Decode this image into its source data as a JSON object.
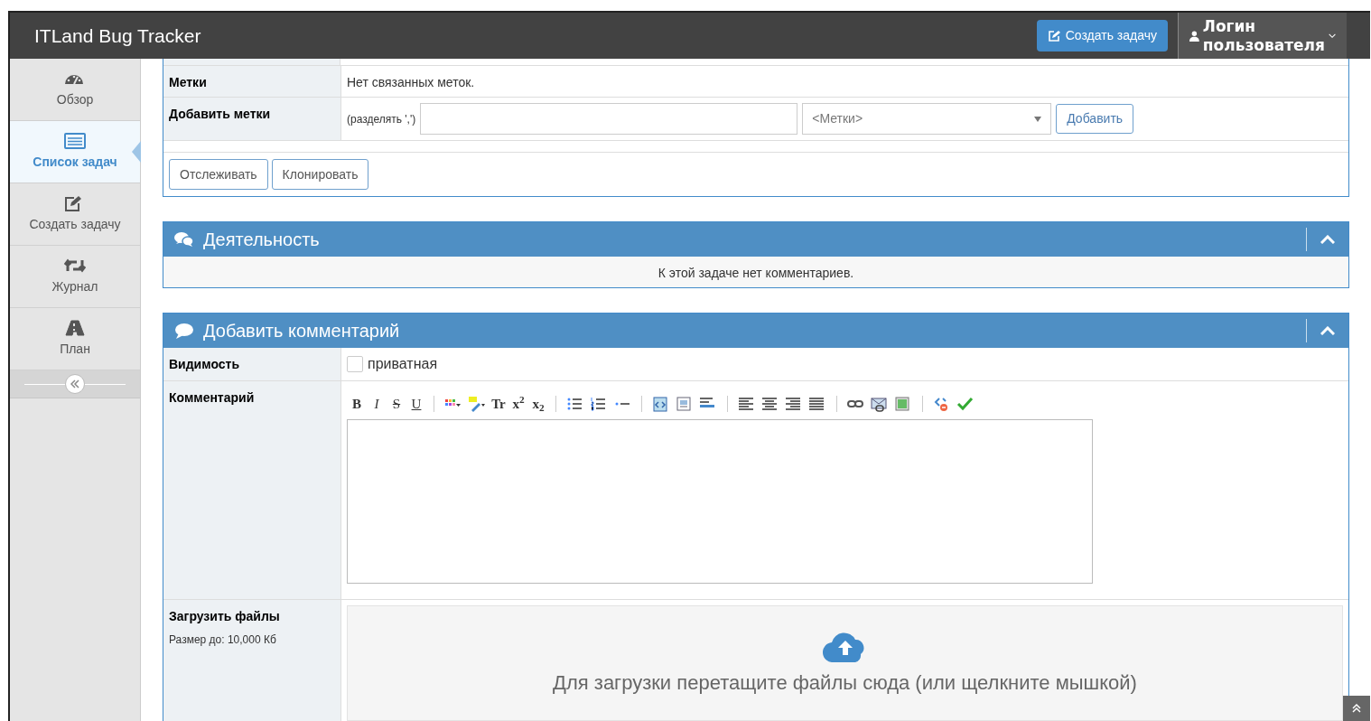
{
  "header": {
    "title": "ITLand Bug Tracker",
    "create_button": "Создать задачу",
    "user_menu": "Логин пользователя"
  },
  "sidebar": {
    "items": [
      {
        "kind": "overview",
        "label": "Обзор",
        "selected": false
      },
      {
        "kind": "list",
        "label": "Список задач",
        "selected": true
      },
      {
        "kind": "create",
        "label": "Создать задачу",
        "selected": false
      },
      {
        "kind": "journal",
        "label": "Журнал",
        "selected": false
      },
      {
        "kind": "plan",
        "label": "План",
        "selected": false
      }
    ]
  },
  "details": {
    "rows": [
      {
        "kind": "text",
        "label": "Метки",
        "value": "Нет связанных меток."
      },
      {
        "kind": "add_tags",
        "label": "Добавить метки",
        "hint": "(разделять ',')",
        "select_placeholder": "<Метки>",
        "button": "Добавить"
      }
    ],
    "buttons": [
      "Отслеживать",
      "Клонировать"
    ]
  },
  "activity": {
    "title": "Деятельность",
    "expanded": true,
    "empty_text": "К этой задаче нет комментариев."
  },
  "add_comment": {
    "title": "Добавить комментарий",
    "expanded": true,
    "visibility": {
      "label": "Видимость",
      "option": "приватная",
      "checked": false
    },
    "comment": {
      "label": "Комментарий",
      "toolbar": [
        [
          {
            "kind": "letter",
            "label": "B"
          },
          {
            "kind": "letter",
            "label": "I"
          },
          {
            "kind": "letter",
            "label": "S"
          },
          {
            "kind": "letter",
            "label": "U"
          }
        ],
        [
          {
            "kind": "colors"
          },
          {
            "kind": "highlight"
          },
          {
            "kind": "letter",
            "label": "Tr"
          },
          {
            "kind": "letter",
            "label": "x$^{2}$"
          },
          {
            "kind": "letter",
            "label": "x$_{2}$"
          }
        ],
        [
          {
            "kind": "bullets"
          },
          {
            "kind": "numbers"
          },
          {
            "kind": "rule"
          }
        ],
        [
          {
            "kind": "source"
          },
          {
            "kind": "quote"
          },
          {
            "kind": "format"
          }
        ],
        [
          {
            "kind": "align_left"
          },
          {
            "kind": "align_center"
          },
          {
            "kind": "align_right"
          },
          {
            "kind": "align_justify"
          }
        ],
        [
          {
            "kind": "link"
          },
          {
            "kind": "email"
          },
          {
            "kind": "image"
          }
        ],
        [
          {
            "kind": "clean"
          },
          {
            "kind": "check"
          }
        ]
      ]
    },
    "upload": {
      "label": "Загрузить файлы",
      "size_note": "Размер до: 10,000 Кб",
      "drop_text": "Для загрузки перетащите файлы сюда (или щелкните мышкой)"
    }
  }
}
